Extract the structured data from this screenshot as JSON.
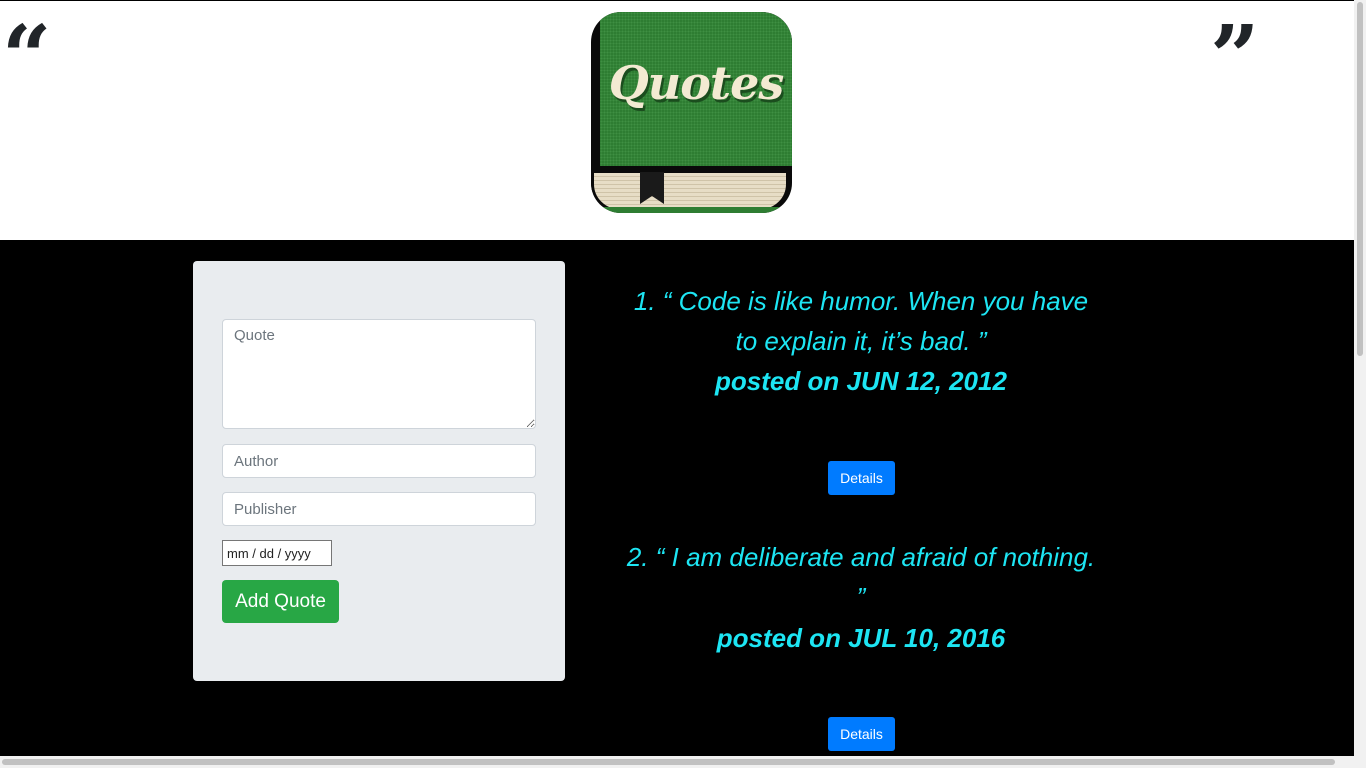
{
  "header": {
    "open_quote": "“",
    "close_quote": "”",
    "logo_text": "Quotes"
  },
  "form": {
    "quote_placeholder": "Quote",
    "author_placeholder": "Author",
    "publisher_placeholder": "Publisher",
    "date_placeholder": "mm / dd / yyyy",
    "submit_label": "Add Quote"
  },
  "quotes": [
    {
      "text_line1": "1. “ Code is like humor. When you have",
      "text_line2": "to explain it, it’s bad. ”",
      "posted": "posted on JUN 12, 2012",
      "details_label": "Details"
    },
    {
      "text_line1": "2. “ I am deliberate and afraid of nothing.",
      "text_line2": "”",
      "posted": "posted on JUL 10, 2016",
      "details_label": "Details"
    }
  ],
  "colors": {
    "accent_text": "#1de5f3",
    "primary_button": "#007bff",
    "success_button": "#28a745",
    "logo_green": "#2e7d32"
  }
}
